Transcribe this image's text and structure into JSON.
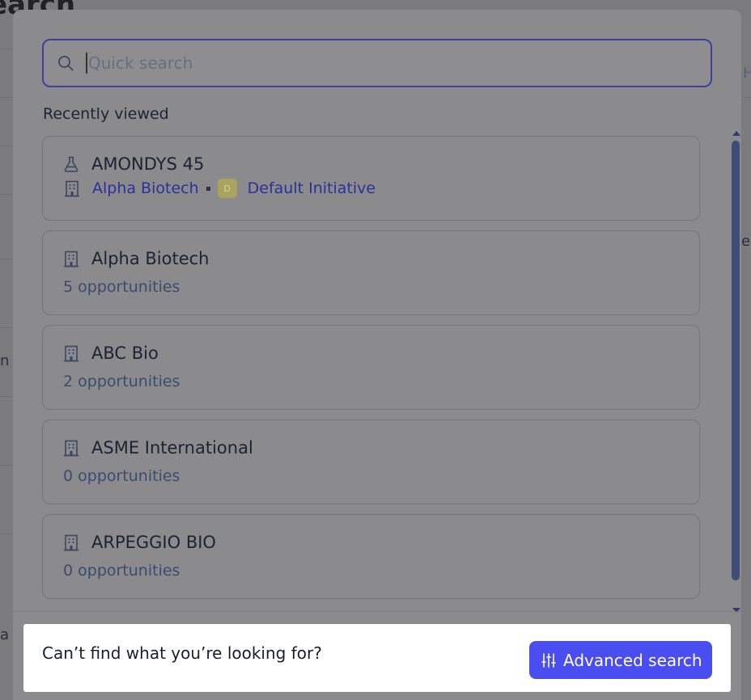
{
  "background": {
    "title": "earch",
    "fragments": [
      "H",
      "e",
      "n",
      "a /"
    ]
  },
  "search": {
    "placeholder": "Quick search",
    "value": ""
  },
  "recent": {
    "label": "Recently viewed",
    "items": [
      {
        "type": "product",
        "icon": "flask-icon",
        "title": "AMONDYS 45",
        "company": "Alpha Biotech",
        "badge": "D",
        "initiative": "Default Initiative"
      },
      {
        "type": "company",
        "icon": "building-icon",
        "title": "Alpha Biotech",
        "subtitle": "5 opportunities"
      },
      {
        "type": "company",
        "icon": "building-icon",
        "title": "ABC Bio",
        "subtitle": "2 opportunities"
      },
      {
        "type": "company",
        "icon": "building-icon",
        "title": "ASME International",
        "subtitle": "0 opportunities"
      },
      {
        "type": "company",
        "icon": "building-icon",
        "title": "ARPEGGIO BIO",
        "subtitle": "0 opportunities"
      }
    ]
  },
  "footer": {
    "prompt": "Can’t find what you’re looking for?",
    "button_label": "Advanced search",
    "button_icon": "sliders-icon"
  },
  "colors": {
    "accent": "#4a4df0",
    "overlay": "#8b8b8d"
  }
}
